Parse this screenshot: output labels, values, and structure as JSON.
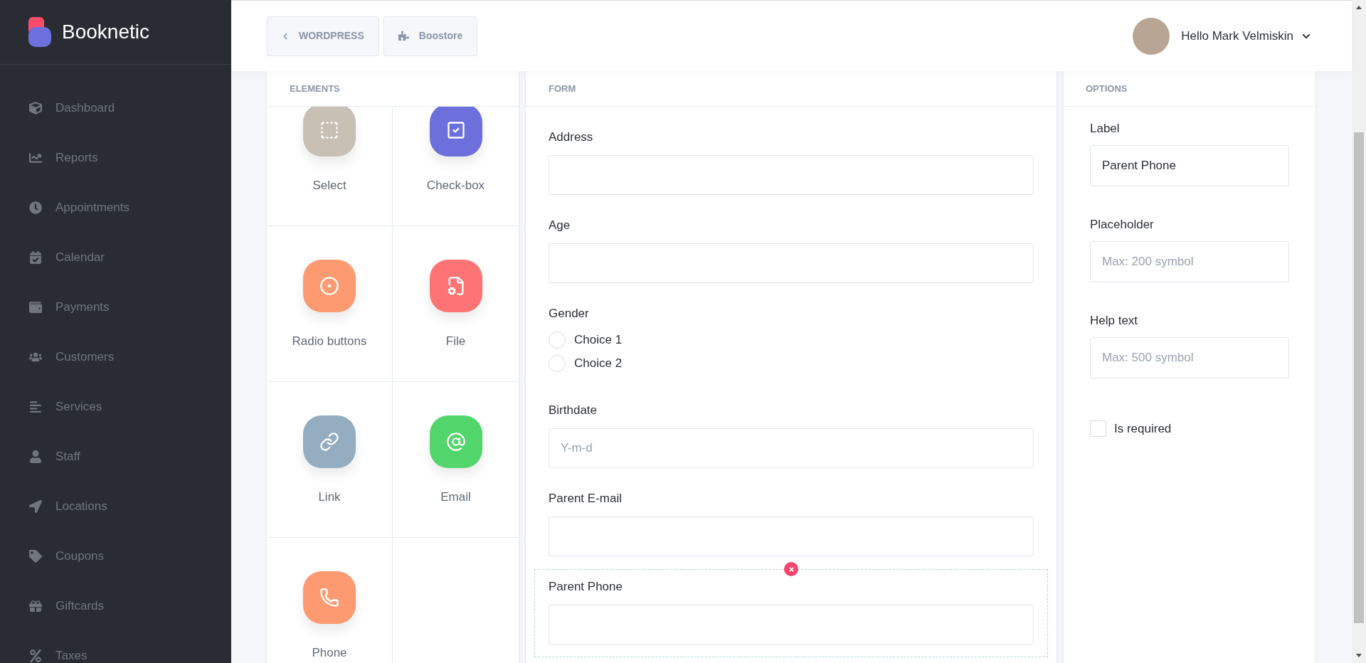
{
  "sidebar": {
    "brand": "Booknetic",
    "items": [
      {
        "label": "Dashboard",
        "selected": false
      },
      {
        "label": "Reports",
        "selected": false
      },
      {
        "label": "Appointments",
        "selected": false
      },
      {
        "label": "Calendar",
        "selected": false
      },
      {
        "label": "Payments",
        "selected": false
      },
      {
        "label": "Customers",
        "selected": false
      },
      {
        "label": "Services",
        "selected": false
      },
      {
        "label": "Staff",
        "selected": false
      },
      {
        "label": "Locations",
        "selected": false
      },
      {
        "label": "Coupons",
        "selected": false
      },
      {
        "label": "Giftcards",
        "selected": false
      },
      {
        "label": "Taxes",
        "selected": false
      }
    ]
  },
  "header": {
    "buttons": [
      {
        "kind": "back",
        "label": "WORDPRESS"
      },
      {
        "kind": "store",
        "label": "Boostore"
      }
    ],
    "greeting": "Hello Mark Velmiskin"
  },
  "elements": {
    "title": "ELEMENTS",
    "items": [
      {
        "kind": "select",
        "label": "Select",
        "color": "#c8c0b5"
      },
      {
        "kind": "checkbox",
        "label": "Check-box",
        "color": "#6c6fdc"
      },
      {
        "kind": "radio",
        "label": "Radio buttons",
        "color": "#fd9a72"
      },
      {
        "kind": "file",
        "label": "File",
        "color": "#fe7373"
      },
      {
        "kind": "link",
        "label": "Link",
        "color": "#94adc0"
      },
      {
        "kind": "email",
        "label": "Email",
        "color": "#52d56b"
      },
      {
        "kind": "phone",
        "label": "Phone",
        "color": "#fd9a72"
      }
    ]
  },
  "form": {
    "title": "FORM",
    "fields": [
      {
        "kind": "text",
        "label": "Address",
        "selected": false
      },
      {
        "kind": "text",
        "label": "Age",
        "selected": false
      },
      {
        "kind": "radio",
        "label": "Gender",
        "selected": false,
        "options": [
          {
            "label": "Choice 1",
            "selected": false
          },
          {
            "label": "Choice 2",
            "selected": false
          }
        ]
      },
      {
        "kind": "text",
        "label": "Birthdate",
        "placeholder": "Y-m-d",
        "selected": false
      },
      {
        "kind": "text",
        "label": "Parent E-mail",
        "selected": false
      },
      {
        "kind": "text",
        "label": "Parent Phone",
        "selected": true
      }
    ]
  },
  "options": {
    "title": "OPTIONS",
    "fields": [
      {
        "label": "Label",
        "value": "Parent Phone"
      },
      {
        "label": "Placeholder",
        "placeholder": "Max: 200 symbol"
      },
      {
        "label": "Help text",
        "placeholder": "Max: 500 symbol"
      }
    ],
    "required": {
      "label": "Is required",
      "checked": false
    }
  }
}
